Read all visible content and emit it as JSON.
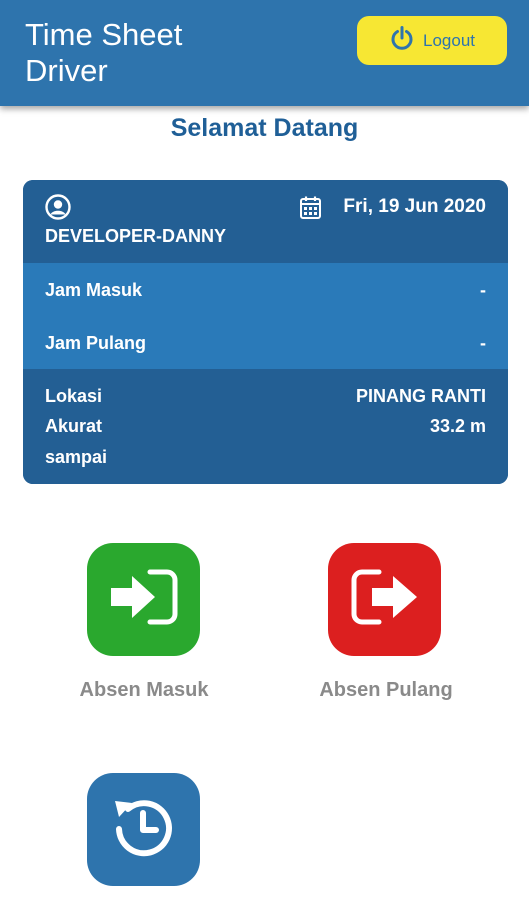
{
  "appbar": {
    "title": "Time Sheet Driver",
    "logout_label": "Logout"
  },
  "welcome": "Selamat Datang",
  "card": {
    "username": "DEVELOPER-DANNY",
    "date": "Fri, 19 Jun 2020",
    "jam_masuk_label": "Jam Masuk",
    "jam_masuk_value": "-",
    "jam_pulang_label": "Jam Pulang",
    "jam_pulang_value": "-",
    "lokasi_label": "Lokasi",
    "lokasi_value": "PINANG RANTI",
    "akurat_label": "Akurat",
    "akurat_value": "33.2 m",
    "sampai_label": "sampai"
  },
  "actions": [
    {
      "label": "Absen Masuk",
      "icon": "login-icon",
      "color": "#2aa82e"
    },
    {
      "label": "Absen Pulang",
      "icon": "logout-arrow-icon",
      "color": "#dc1f1f"
    },
    {
      "label": "",
      "icon": "history-icon",
      "color": "#2e74ad"
    }
  ],
  "colors": {
    "primary": "#2e74ad",
    "logout_bg": "#f7e733",
    "card_dark": "#235f94",
    "card_mid": "#2a7ab9"
  }
}
